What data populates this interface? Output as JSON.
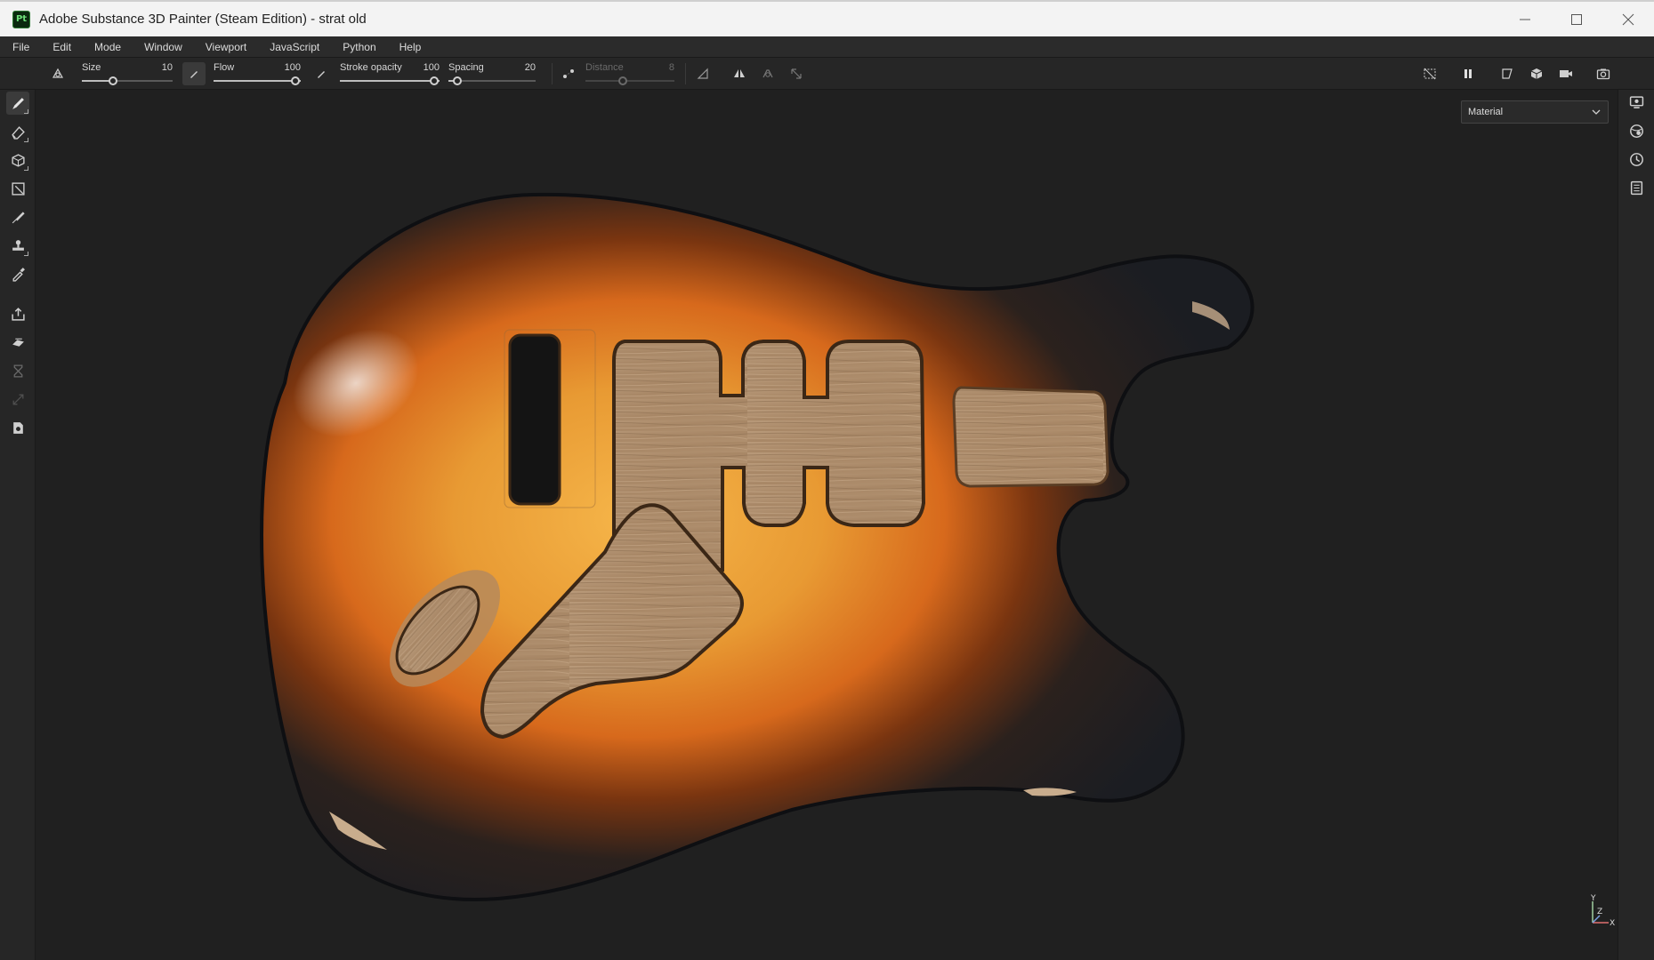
{
  "window": {
    "title": "Adobe Substance 3D Painter (Steam Edition) - strat old",
    "app_icon_text": "Pt"
  },
  "menu": [
    "File",
    "Edit",
    "Mode",
    "Window",
    "Viewport",
    "JavaScript",
    "Python",
    "Help"
  ],
  "tool_options": {
    "size": {
      "label": "Size",
      "value": "10",
      "fraction": 0.33
    },
    "flow": {
      "label": "Flow",
      "value": "100",
      "fraction": 1.0
    },
    "stroke_opacity": {
      "label": "Stroke opacity",
      "value": "100",
      "fraction": 1.0
    },
    "spacing": {
      "label": "Spacing",
      "value": "20",
      "fraction": 0.02
    },
    "distance": {
      "label": "Distance",
      "value": "8",
      "fraction": 0.5,
      "disabled": true
    }
  },
  "viewport": {
    "mode": "Material",
    "axis_labels": {
      "y": "Y",
      "z": "Z",
      "x": "X"
    }
  },
  "colors": {
    "accent_icon": "#2d7a33",
    "bg_viewport": "#202020",
    "panel": "#262626"
  }
}
